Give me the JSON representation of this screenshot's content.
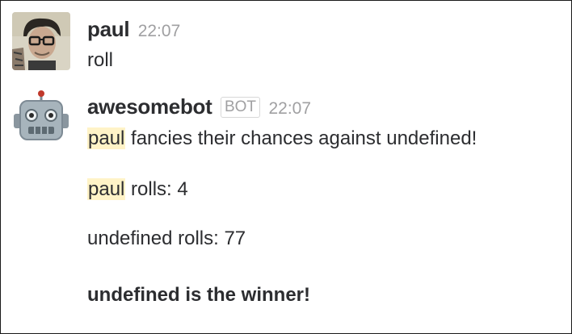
{
  "messages": [
    {
      "author": "paul",
      "time": "22:07",
      "avatar_icon": "user-photo-avatar",
      "text": "roll"
    },
    {
      "author": "awesomebot",
      "badge": "BOT",
      "time": "22:07",
      "avatar_icon": "robot-icon",
      "lines": [
        {
          "mention": "paul",
          "text": " fancies their chances against undefined!"
        },
        {
          "mention": "paul",
          "text": " rolls: 4"
        },
        {
          "text": "undefined rolls: 77"
        },
        {
          "text": "undefined is the winner!"
        }
      ]
    }
  ],
  "colors": {
    "mention_bg": "#fff3c7",
    "text": "#2c2d30",
    "muted": "#a0a0a2"
  }
}
